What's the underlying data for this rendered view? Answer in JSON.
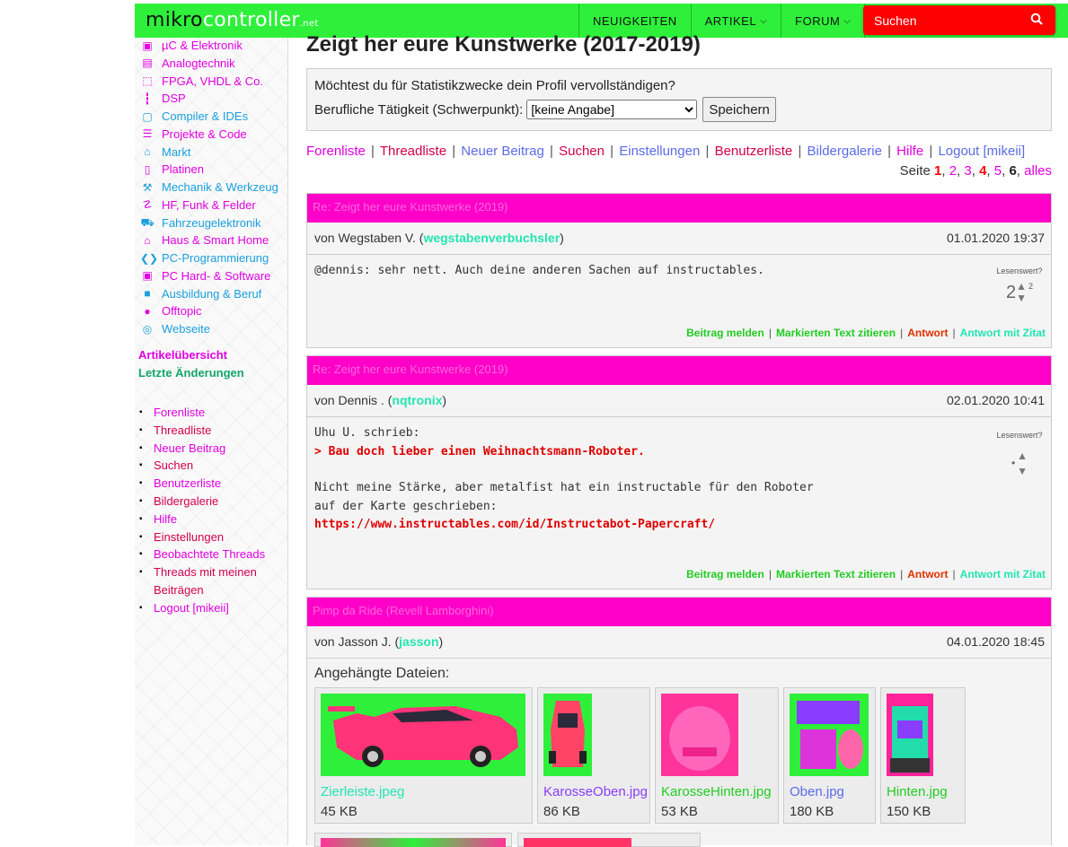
{
  "header": {
    "logo_main": "mikro",
    "logo_light": "controller",
    "logo_net": ".net",
    "nav": [
      {
        "label": "NEUIGKEITEN",
        "has_dropdown": false
      },
      {
        "label": "ARTIKEL",
        "has_dropdown": true
      },
      {
        "label": "FORUM",
        "has_dropdown": true
      }
    ],
    "search_label": "Suchen"
  },
  "sidebar": {
    "categories": [
      {
        "label": "µC & Elektronik",
        "icon": "chip-icon",
        "color": "#e000e0"
      },
      {
        "label": "Analogtechnik",
        "icon": "analog-icon",
        "color": "#e000e0"
      },
      {
        "label": "FPGA, VHDL & Co.",
        "icon": "fpga-icon",
        "color": "#e000e0"
      },
      {
        "label": "DSP",
        "icon": "waveform-icon",
        "color": "#e000e0"
      },
      {
        "label": "Compiler & IDEs",
        "icon": "monitor-icon",
        "color": "#1a9fdc"
      },
      {
        "label": "Projekte & Code",
        "icon": "projects-icon",
        "color": "#e000e0"
      },
      {
        "label": "Markt",
        "icon": "cart-icon",
        "color": "#1a9fdc"
      },
      {
        "label": "Platinen",
        "icon": "board-icon",
        "color": "#e000e0"
      },
      {
        "label": "Mechanik & Werkzeug",
        "icon": "wrench-icon",
        "color": "#1a9fdc"
      },
      {
        "label": "HF, Funk & Felder",
        "icon": "antenna-icon",
        "color": "#e000e0"
      },
      {
        "label": "Fahrzeugelektronik",
        "icon": "car-icon",
        "color": "#1a9fdc"
      },
      {
        "label": "Haus & Smart Home",
        "icon": "house-icon",
        "color": "#e000e0"
      },
      {
        "label": "PC-Programmierung",
        "icon": "code-icon",
        "color": "#1a9fdc"
      },
      {
        "label": "PC Hard- & Software",
        "icon": "pc-icon",
        "color": "#e000e0"
      },
      {
        "label": "Ausbildung & Beruf",
        "icon": "book-icon",
        "color": "#1a9fdc"
      },
      {
        "label": "Offtopic",
        "icon": "chat-icon",
        "color": "#e000e0"
      },
      {
        "label": "Webseite",
        "icon": "globe-icon",
        "color": "#1a9fdc"
      }
    ],
    "artikel_overview": "Artikelübersicht",
    "latest_changes": "Letzte Änderungen",
    "forum_links": [
      {
        "label": "Forenliste",
        "color": "#e000e0"
      },
      {
        "label": "Threadliste",
        "color": "#d4004a"
      },
      {
        "label": "Neuer Beitrag",
        "color": "#e000e0"
      },
      {
        "label": "Suchen",
        "color": "#d4004a"
      },
      {
        "label": "Benutzerliste",
        "color": "#e000e0"
      },
      {
        "label": "Bildergalerie",
        "color": "#d4004a"
      },
      {
        "label": "Hilfe",
        "color": "#e000e0"
      },
      {
        "label": "Einstellungen",
        "color": "#d4004a"
      },
      {
        "label": "Beobachtete Threads",
        "color": "#e000e0"
      },
      {
        "label": "Threads mit meinen Beiträgen",
        "color": "#d4004a"
      },
      {
        "label": "Logout [mikeii]",
        "color": "#e000e0"
      }
    ]
  },
  "main": {
    "title": "Zeigt her eure Kunstwerke (2017-2019)",
    "profile": {
      "question": "Möchtest du für Statistikzwecke dein Profil vervollständigen?",
      "field_label": "Berufliche Tätigkeit (Schwerpunkt):",
      "select_value": "[keine Angabe]",
      "save_label": "Speichern"
    },
    "forum_nav": [
      {
        "label": "Forenliste",
        "color": "#e000e0"
      },
      {
        "label": "Threadliste",
        "color": "#d4004a"
      },
      {
        "label": "Neuer Beitrag",
        "color": "#5b6be8"
      },
      {
        "label": "Suchen",
        "color": "#d4004a"
      },
      {
        "label": "Einstellungen",
        "color": "#5b6be8"
      },
      {
        "label": "Benutzerliste",
        "color": "#d4004a"
      },
      {
        "label": "Bildergalerie",
        "color": "#5b6be8"
      },
      {
        "label": "Hilfe",
        "color": "#e000e0"
      },
      {
        "label": "Logout [mikeii]",
        "color": "#5b6be8"
      }
    ],
    "pager": {
      "prefix": "Seite",
      "pages": [
        {
          "label": "1",
          "color": "#ff0000",
          "current": false
        },
        {
          "label": "2",
          "color": "#e000e0",
          "current": false
        },
        {
          "label": "3",
          "color": "#e000e0",
          "current": false
        },
        {
          "label": "4",
          "color": "#ff0000",
          "current": false
        },
        {
          "label": "5",
          "color": "#e000e0",
          "current": false
        },
        {
          "label": "6",
          "color": "#222222",
          "current": true
        }
      ],
      "all_label": "alles"
    },
    "posts": [
      {
        "subject": "Re: Zeigt her eure Kunstwerke (2019)",
        "author": "Wegstaben V.",
        "username": "wegstabenverbuchsler",
        "date": "01.01.2020 19:37",
        "body_line1": "@dennis: sehr nett. Auch deine anderen Sachen auf instructables.",
        "rating_label": "Lesenswert?",
        "rating_score": "2",
        "rating_votes": "2"
      },
      {
        "subject": "Re: Zeigt her eure Kunstwerke (2019)",
        "author": "Dennis  .",
        "username": "nqtronix",
        "date": "02.01.2020 10:41",
        "quote_intro": "Uhu U. schrieb:",
        "quote_text": "> Bau doch lieber einen Weihnachtsmann-Roboter.",
        "body_line1": "Nicht meine Stärke, aber metalfist hat ein instructable für den Roboter",
        "body_line2": "auf der Karte geschrieben:",
        "url": "https://www.instructables.com/id/Instructabot-Papercraft/",
        "rating_label": "Lesenswert?",
        "rating_score": "•"
      },
      {
        "subject": "Pimp da Ride (Revell Lamborghini)",
        "author": "Jasson J.",
        "username": "jasson",
        "date": "04.01.2020 18:45",
        "attachments_title": "Angehängte Dateien:",
        "attachments": [
          {
            "name": "Zierleiste.jpeg",
            "size": "45 KB",
            "color": "#22e6b0"
          },
          {
            "name": "KarosseOben.jpg",
            "size": "86 KB",
            "color": "#8a3cff"
          },
          {
            "name": "KarosseHinten.jpg",
            "size": "53 KB",
            "color": "#22cc22"
          },
          {
            "name": "Oben.jpg",
            "size": "180 KB",
            "color": "#5b6be8"
          },
          {
            "name": "Hinten.jpg",
            "size": "150 KB",
            "color": "#22cc22"
          }
        ]
      }
    ],
    "actions": {
      "report": "Beitrag melden",
      "quote_marked": "Markierten Text zitieren",
      "reply": "Antwort",
      "reply_quote": "Antwort mit Zitat"
    }
  },
  "colors": {
    "accent_green": "#2ef03a",
    "post_header": "#ff00c8",
    "search_red": "#ff0000"
  }
}
